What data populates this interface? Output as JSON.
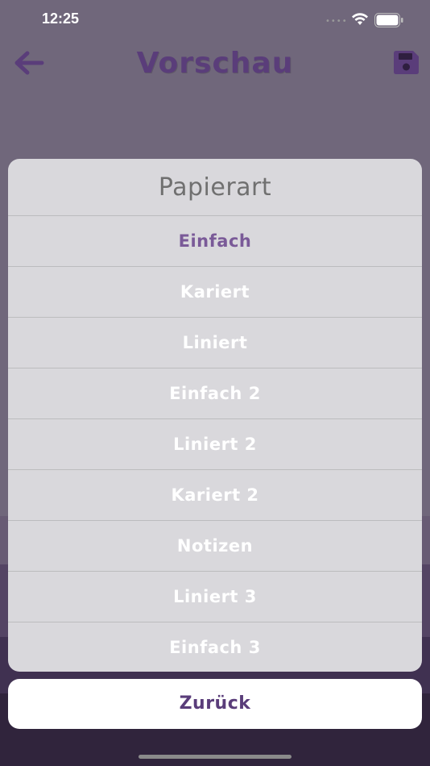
{
  "status_bar": {
    "time": "12:25"
  },
  "header": {
    "title": "Vorschau",
    "back_icon": "arrow-left-icon",
    "save_icon": "floppy-disk-icon"
  },
  "sheet": {
    "title": "Papierart",
    "items": [
      {
        "label": "Einfach",
        "selected": true
      },
      {
        "label": "Kariert",
        "selected": false
      },
      {
        "label": "Liniert",
        "selected": false
      },
      {
        "label": "Einfach 2",
        "selected": false
      },
      {
        "label": "Liniert 2",
        "selected": false
      },
      {
        "label": "Kariert 2",
        "selected": false
      },
      {
        "label": "Notizen",
        "selected": false
      },
      {
        "label": "Liniert 3",
        "selected": false
      },
      {
        "label": "Einfach 3",
        "selected": false
      }
    ],
    "cancel_label": "Zurück"
  },
  "colors": {
    "accent": "#5a3d7a",
    "selected_item": "#7a5a98",
    "sheet_background": "#d9d8dc"
  }
}
